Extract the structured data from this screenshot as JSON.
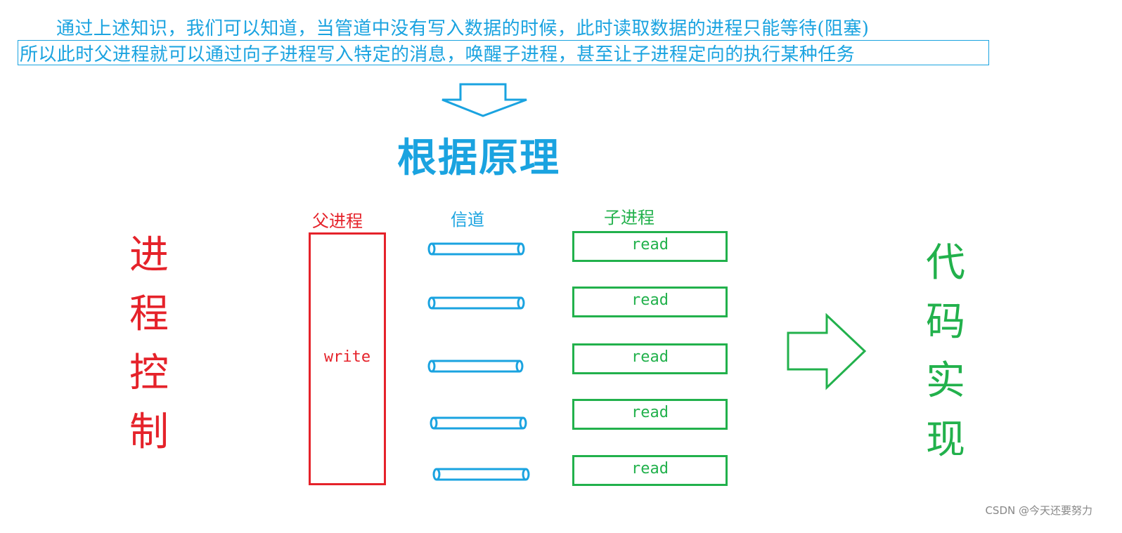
{
  "text": {
    "line1": "通过上述知识，我们可以知道，当管道中没有写入数据的时候，此时读取数据的进程只能等待(阻塞)",
    "line2": "所以此时父进程就可以通过向子进程写入特定的消息，唤醒子进程，甚至让子进程定向的执行某种任务",
    "title": "根据原理",
    "left_vertical": [
      "进",
      "程",
      "控",
      "制"
    ],
    "right_vertical": [
      "代",
      "码",
      "实",
      "现"
    ],
    "parent_label": "父进程",
    "channel_label": "信道",
    "child_label": "子进程",
    "parent_box_text": "write",
    "child_boxes": [
      "read",
      "read",
      "read",
      "read",
      "read"
    ],
    "footer": "CSDN @今天还要努力"
  },
  "icons": {
    "down_arrow": "outline-down-arrow-icon",
    "right_arrow": "outline-right-arrow-icon",
    "pipe": "pipe-cylinder-icon"
  },
  "colors": {
    "blue": "#1aa3e0",
    "red": "#e5222a",
    "green": "#22b14c",
    "footer": "#888888"
  }
}
